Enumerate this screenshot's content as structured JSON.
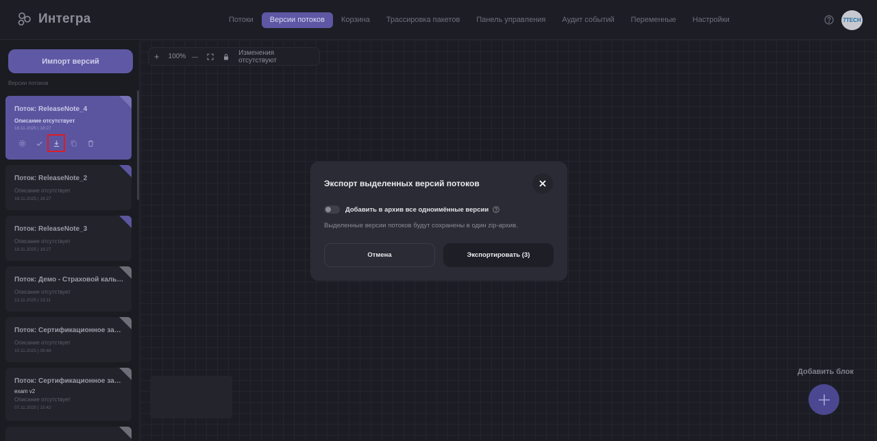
{
  "app": {
    "name": "Интегра",
    "avatar_text": "7TECH"
  },
  "nav": {
    "items": [
      {
        "label": "Потоки",
        "active": false
      },
      {
        "label": "Версии потоков",
        "active": true
      },
      {
        "label": "Корзина",
        "active": false
      },
      {
        "label": "Трассировка пакетов",
        "active": false
      },
      {
        "label": "Панель управления",
        "active": false
      },
      {
        "label": "Аудит событий",
        "active": false
      },
      {
        "label": "Переменные",
        "active": false
      },
      {
        "label": "Настройки",
        "active": false
      }
    ]
  },
  "sidebar": {
    "import_label": "Импорт версий",
    "section_label": "Версии потоков",
    "cards": [
      {
        "title": "Поток: ReleaseNote_4",
        "subtitle": "",
        "description": "Описание отсутствует",
        "date": "18.11.2025 | 18:27",
        "selected": true
      },
      {
        "title": "Поток: ReleaseNote_2",
        "subtitle": "",
        "description": "Описание отсутствует",
        "date": "18.11.2025 | 18:27",
        "selected": false
      },
      {
        "title": "Поток: ReleaseNote_3",
        "subtitle": "",
        "description": "Описание отсутствует",
        "date": "18.11.2025 | 18:27",
        "selected": false
      },
      {
        "title": "Поток: Демо - Страховой калькулятор",
        "subtitle": "",
        "description": "Описание отсутствует",
        "date": "12.11.2025 | 13:11",
        "selected": false
      },
      {
        "title": "Поток: Сертификационное задание",
        "subtitle": "",
        "description": "Описание отсутствует",
        "date": "10.11.2025 | 09:48",
        "selected": false
      },
      {
        "title": "Поток: Сертификационное задание",
        "subtitle": "exam v2",
        "description": "Описание отсутствует",
        "date": "07.11.2025 | 15:42",
        "selected": false
      }
    ],
    "card_actions": [
      "settings-icon",
      "check-icon",
      "download-icon",
      "copy-icon",
      "trash-icon"
    ]
  },
  "toolbar": {
    "zoom_in": "+",
    "zoom_level": "100%",
    "zoom_out": "—",
    "status": "Изменения отсутствуют"
  },
  "canvas": {
    "add_block_label": "Добавить блок"
  },
  "modal": {
    "title": "Экспорт выделенных версий потоков",
    "toggle_label": "Добавить в архив все одноимённые версии",
    "toggle_on": false,
    "description": "Выделенные версии потоков будут сохранены в один zip-архив.",
    "cancel_label": "Отмена",
    "export_label": "Экспортировать (3)"
  },
  "colors": {
    "accent": "#5d57a4",
    "highlight": "#e01b24",
    "background": "#1b1c22"
  }
}
